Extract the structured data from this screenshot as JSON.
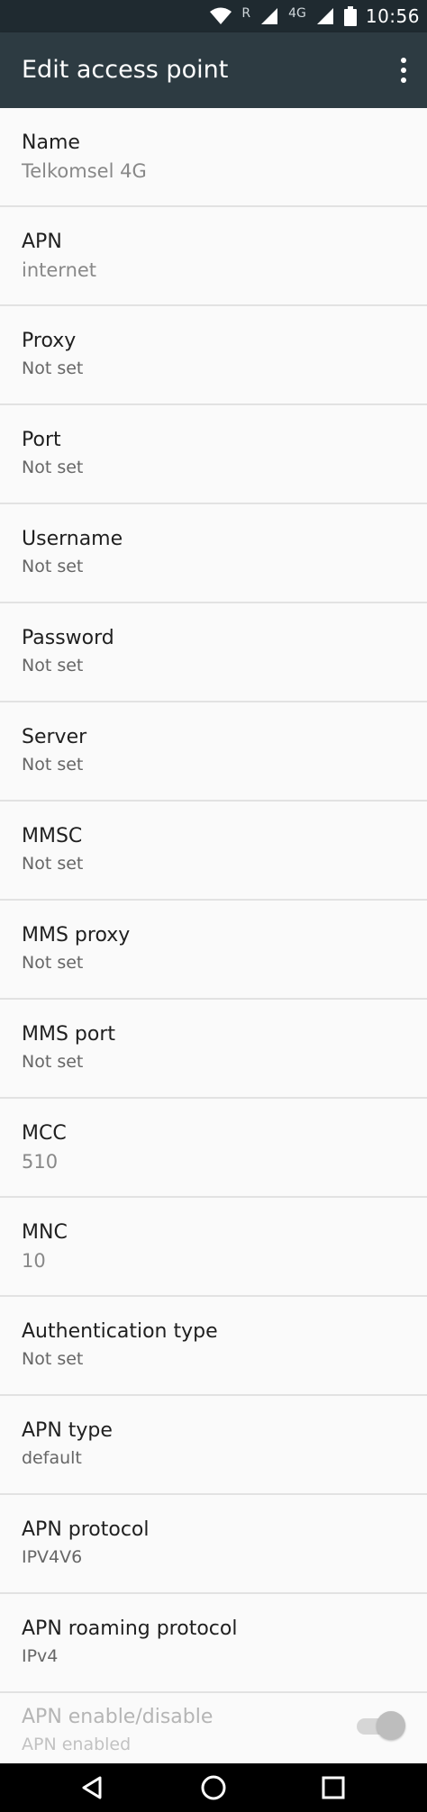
{
  "status": {
    "network": "4G",
    "roaming": "R",
    "time": "10:56"
  },
  "header": {
    "title": "Edit access point"
  },
  "fields": [
    {
      "label": "Name",
      "value": "Telkomsel 4G"
    },
    {
      "label": "APN",
      "value": "internet"
    },
    {
      "label": "Proxy",
      "value": "Not set"
    },
    {
      "label": "Port",
      "value": "Not set"
    },
    {
      "label": "Username",
      "value": "Not set"
    },
    {
      "label": "Password",
      "value": "Not set"
    },
    {
      "label": "Server",
      "value": "Not set"
    },
    {
      "label": "MMSC",
      "value": "Not set"
    },
    {
      "label": "MMS proxy",
      "value": "Not set"
    },
    {
      "label": "MMS port",
      "value": "Not set"
    },
    {
      "label": "MCC",
      "value": "510"
    },
    {
      "label": "MNC",
      "value": "10"
    },
    {
      "label": "Authentication type",
      "value": "Not set"
    },
    {
      "label": "APN type",
      "value": "default"
    },
    {
      "label": "APN protocol",
      "value": "IPV4V6"
    },
    {
      "label": "APN roaming protocol",
      "value": "IPv4"
    }
  ],
  "apn_toggle": {
    "label": "APN enable/disable",
    "value": "APN enabled"
  },
  "colors": {
    "app_bar": "#2d3b42",
    "status_bar": "#1f2a30",
    "background": "#fafafa"
  }
}
